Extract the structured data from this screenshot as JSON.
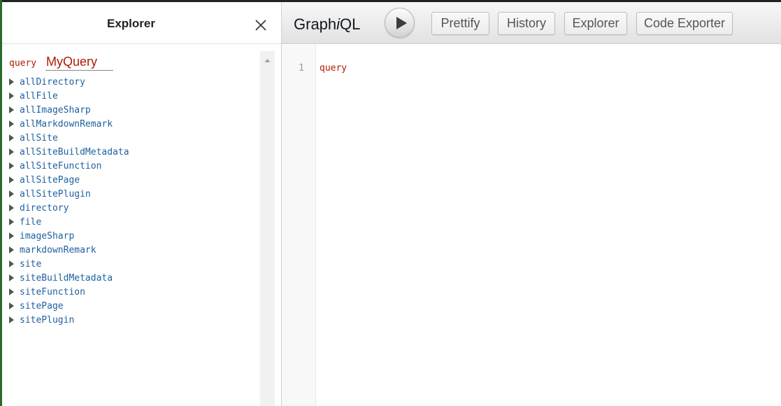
{
  "explorer": {
    "title": "Explorer",
    "query_keyword": "query",
    "query_name": "MyQuery",
    "fields": [
      "allDirectory",
      "allFile",
      "allImageSharp",
      "allMarkdownRemark",
      "allSite",
      "allSiteBuildMetadata",
      "allSiteFunction",
      "allSitePage",
      "allSitePlugin",
      "directory",
      "file",
      "imageSharp",
      "markdownRemark",
      "site",
      "siteBuildMetadata",
      "siteFunction",
      "sitePage",
      "sitePlugin"
    ]
  },
  "toolbar": {
    "title_prefix": "Graph",
    "title_italic": "i",
    "title_suffix": "QL",
    "buttons": {
      "prettify": "Prettify",
      "history": "History",
      "explorer": "Explorer",
      "code_exporter": "Code Exporter"
    }
  },
  "editor": {
    "line_number": "1",
    "code": "query"
  },
  "colors": {
    "keyword": "#b11a04",
    "field": "#1f61a0"
  },
  "icons": [
    "close-icon",
    "play-icon",
    "triangle-right-icon",
    "scroll-up-icon"
  ]
}
